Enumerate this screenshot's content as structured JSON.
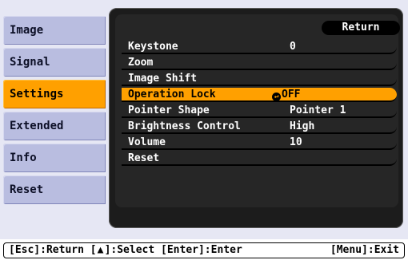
{
  "sidebar": {
    "items": [
      {
        "label": "Image"
      },
      {
        "label": "Signal"
      },
      {
        "label": "Settings",
        "active": true
      },
      {
        "label": "Extended"
      },
      {
        "label": "Info"
      },
      {
        "label": "Reset"
      }
    ]
  },
  "panel": {
    "return_label": "Return",
    "rows": [
      {
        "label": "Keystone",
        "value": "0"
      },
      {
        "label": "Zoom",
        "value": ""
      },
      {
        "label": "Image Shift",
        "value": ""
      },
      {
        "label": "Operation Lock",
        "value": "OFF",
        "icon": "enter-arrow-icon",
        "active": true
      },
      {
        "label": "Pointer Shape",
        "value": "Pointer 1"
      },
      {
        "label": "Brightness Control",
        "value": "High"
      },
      {
        "label": "Volume",
        "value": "10"
      },
      {
        "label": "Reset",
        "value": ""
      }
    ]
  },
  "footer": {
    "esc_text": "[Esc]:Return [",
    "select_text": "]:Select [Enter]:Enter",
    "menu_exit": "[Menu]:Exit"
  },
  "colors": {
    "accent": "#ffa000",
    "sidebar_bg": "#b9bde0",
    "panel_bg": "#1c1c1c"
  }
}
